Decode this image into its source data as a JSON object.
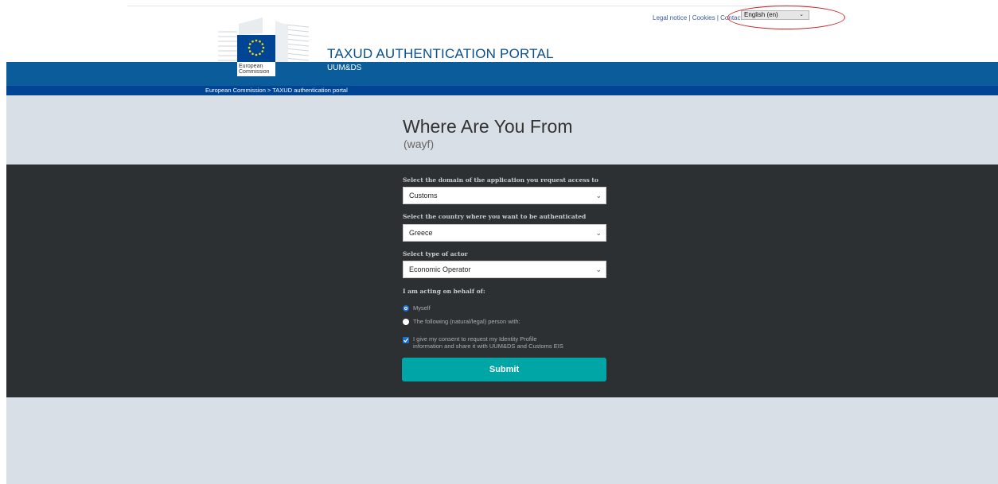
{
  "top_links": {
    "legal_notice": "Legal notice",
    "cookies": "Cookies",
    "contact": "Contact",
    "separator": "|"
  },
  "language_select": {
    "value": "English (en)"
  },
  "logo": {
    "line1": "European",
    "line2": "Commission"
  },
  "header": {
    "title": "TAXUD AUTHENTICATION PORTAL",
    "subtitle": "UUM&DS"
  },
  "breadcrumb": "European Commission > TAXUD authentication portal",
  "page": {
    "title": "Where Are You From",
    "subtitle": "(wayf)"
  },
  "form": {
    "domain_label": "Select the domain of the application you request access to",
    "domain_value": "Customs",
    "country_label": "Select the country where you want to be authenticated",
    "country_value": "Greece",
    "actor_label": "Select type of actor",
    "actor_value": "Economic Operator",
    "behalf_label": "I am acting on behalf of:",
    "radio_myself": "Myself",
    "radio_other": "The following (natural/legal) person with:",
    "consent_line1": "I give my consent to request my Identity Profile",
    "consent_line2": "information and share it with UUM&DS and Customs EIS",
    "submit_label": "Submit"
  },
  "colors": {
    "header_blue": "#0a5c9a",
    "breadcrumb_blue": "#004494",
    "panel_dark": "#2d3033",
    "light_gray": "#d9dfe6",
    "submit_teal": "#00a6a6",
    "annotation_red": "#d02020"
  }
}
